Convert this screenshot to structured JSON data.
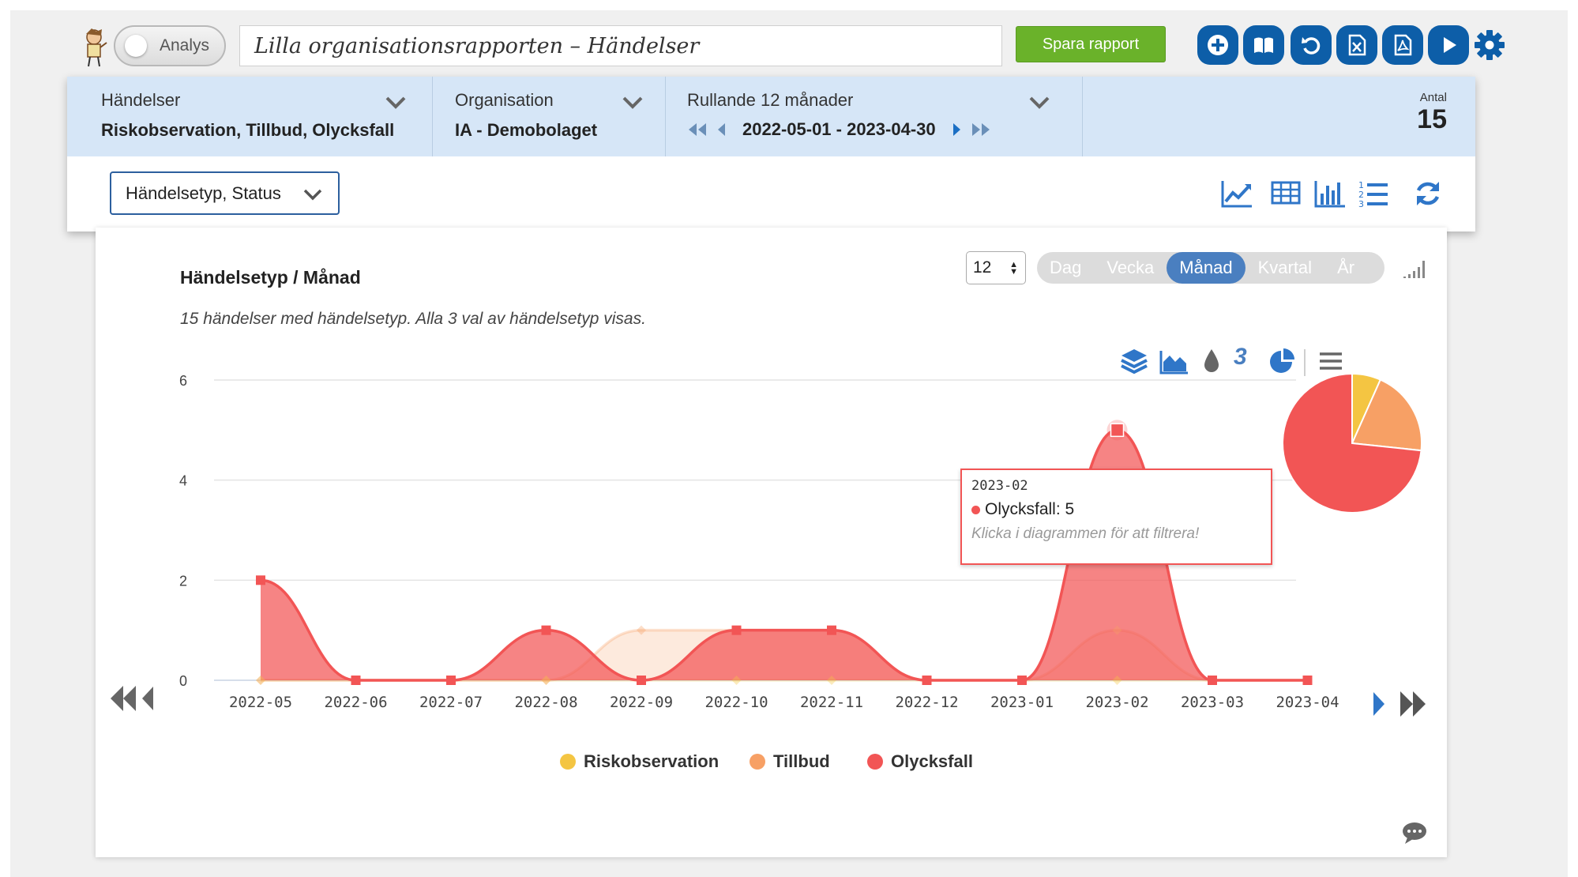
{
  "toolbar": {
    "mode_toggle_label": "Analys",
    "report_title": "Lilla organisationsrapporten – Händelser",
    "save_label": "Spara rapport"
  },
  "filters": {
    "events": {
      "title": "Händelser",
      "value": "Riskobservation, Tillbud, Olycksfall"
    },
    "organisation": {
      "title": "Organisation",
      "value": "IA - Demobolaget"
    },
    "period": {
      "title": "Rullande 12 månader",
      "range": "2022-05-01 - 2023-04-30"
    },
    "count": {
      "label": "Antal",
      "value": "15"
    }
  },
  "grouping": {
    "value": "Händelsetyp, Status"
  },
  "chart": {
    "title": "Händelsetyp / Månad",
    "subtitle": "15 händelser med händelsetyp. Alla 3 val av händelsetyp visas.",
    "period_count": "12",
    "periods": [
      "Dag",
      "Vecka",
      "Månad",
      "Kvartal",
      "År"
    ],
    "active_period": "Månad",
    "series_count_badge": "3",
    "tooltip": {
      "date": "2023-02",
      "series_value": "Olycksfall: 5",
      "hint": "Klicka i diagrammen för att filtrera!"
    }
  },
  "colors": {
    "riskobservation": "#f4c542",
    "tillbud": "#f7a065",
    "olycksfall": "#f25555",
    "accent": "#0d5ea8",
    "save_green": "#6ab22a"
  },
  "chart_data": {
    "type": "area",
    "categories": [
      "2022-05",
      "2022-06",
      "2022-07",
      "2022-08",
      "2022-09",
      "2022-10",
      "2022-11",
      "2022-12",
      "2023-01",
      "2023-02",
      "2023-03",
      "2023-04"
    ],
    "series": [
      {
        "name": "Riskobservation",
        "values": [
          0,
          0,
          0,
          0,
          0,
          0,
          0,
          0,
          0,
          0,
          0,
          0
        ]
      },
      {
        "name": "Tillbud",
        "values": [
          0,
          0,
          0,
          0,
          1,
          1,
          1,
          0,
          0,
          1,
          0,
          0
        ]
      },
      {
        "name": "Olycksfall",
        "values": [
          2,
          0,
          0,
          1,
          0,
          1,
          1,
          0,
          0,
          5,
          0,
          0
        ]
      }
    ],
    "ylim": [
      0,
      6
    ],
    "yticks": [
      0,
      2,
      4,
      6
    ],
    "grid": true,
    "legend": "bottom-center",
    "pie": [
      {
        "name": "Riskobservation",
        "value": 1
      },
      {
        "name": "Tillbud",
        "value": 3
      },
      {
        "name": "Olycksfall",
        "value": 11
      }
    ]
  }
}
